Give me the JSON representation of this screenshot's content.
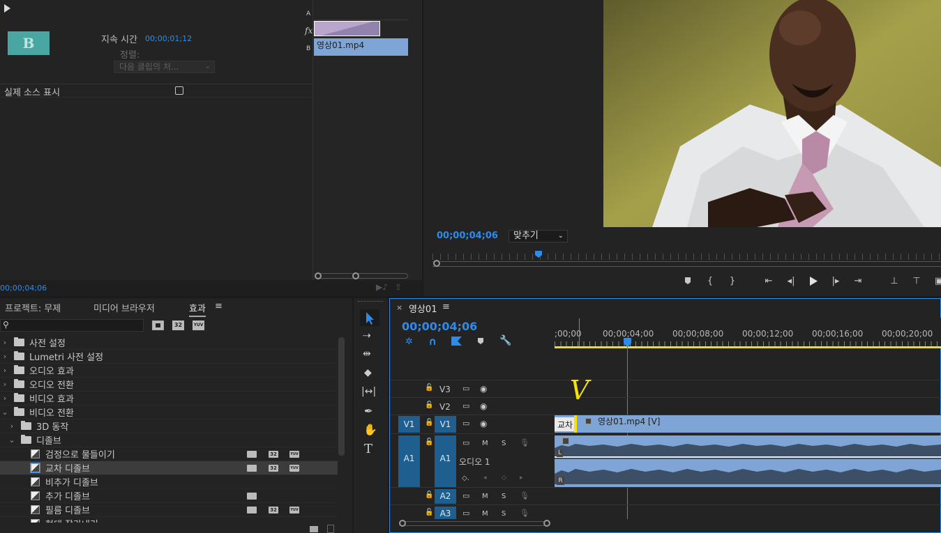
{
  "effect_controls": {
    "duration_label": "지속 시간",
    "duration_value": "00;00;01;12",
    "align_label": "정렬:",
    "align_value": "다음 클립의 처...",
    "show_source_label": "실제 소스 표시",
    "timecode": "00;00;04;06",
    "thumb_letter": "B",
    "mini_clip_name": "영상01.mp4",
    "track_a": "A",
    "track_b": "B"
  },
  "program_monitor": {
    "timecode": "00;00;04;06",
    "zoom_value": "맞추기"
  },
  "project_panel": {
    "tabs": [
      "프로젝트: 무제",
      "미디어 브라우저",
      "효과"
    ],
    "active_tab": "효과",
    "search_placeholder": "",
    "badge_labels": [
      "32",
      "YUV"
    ],
    "items": [
      {
        "label": "사전 설정",
        "level": 0
      },
      {
        "label": "Lumetri 사전 설정",
        "level": 0
      },
      {
        "label": "오디오 효과",
        "level": 0
      },
      {
        "label": "오디오 전환",
        "level": 0
      },
      {
        "label": "비디오 효과",
        "level": 0
      },
      {
        "label": "비디오 전환",
        "level": 0
      },
      {
        "label": "3D 동작",
        "level": 1
      },
      {
        "label": "디졸브",
        "level": 1
      },
      {
        "label": "검정으로 물들이기",
        "level": 2
      },
      {
        "label": "교차 디졸브",
        "level": 2
      },
      {
        "label": "비추가 디졸브",
        "level": 2
      },
      {
        "label": "추가 디졸브",
        "level": 2
      },
      {
        "label": "필름 디졸브",
        "level": 2
      },
      {
        "label": "형태 잘라내기",
        "level": 2
      }
    ]
  },
  "timeline": {
    "tab_title": "영상01",
    "timecode": "00;00;04;06",
    "ruler_labels": [
      ";00;00",
      "00;00;04;00",
      "00;00;08;00",
      "00;00;12;00",
      "00;00;16;00",
      "00;00;20;00"
    ],
    "tracks": {
      "v3": "V3",
      "v2": "V2",
      "v1": "V1",
      "v1_src": "V1",
      "a1": "A1",
      "a1_src": "A1",
      "a2": "A2",
      "a3": "A3",
      "mute": "M",
      "solo": "S",
      "audio_name": "오디오 1"
    },
    "clip_v_label": "영상01.mp4 [V]",
    "transition_label": "교차",
    "audio_channel_l": "L",
    "audio_channel_r": "R",
    "annotation": "V"
  },
  "colors": {
    "accent_blue": "#2d8ceb",
    "clip_blue": "#7fa4d6",
    "yellow": "#f5e200",
    "track_blue": "#1f5f8f"
  }
}
